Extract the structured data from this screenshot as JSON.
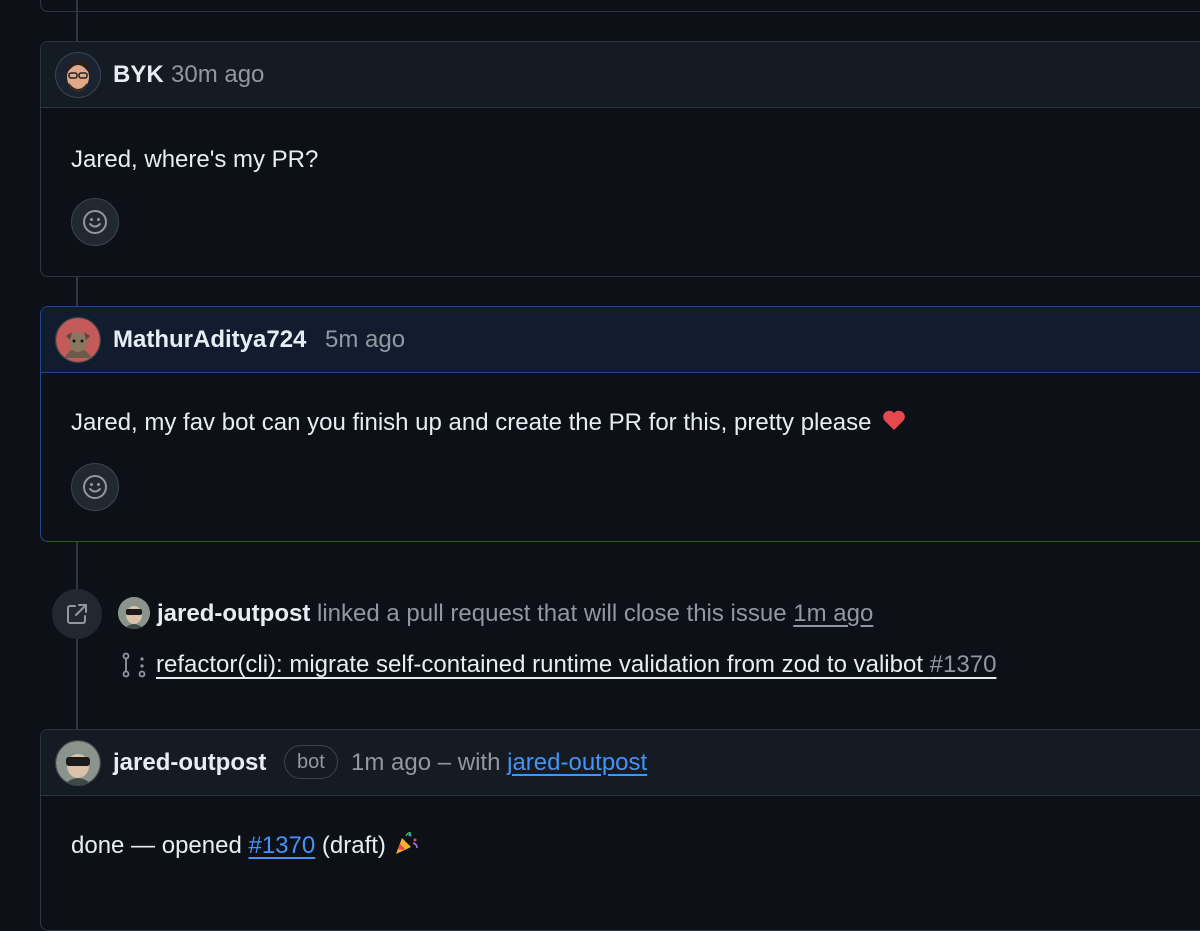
{
  "comments": [
    {
      "author": "BYK",
      "time": "30m ago",
      "body": "Jared, where's my PR?"
    },
    {
      "author": "MathurAditya724",
      "time": "5m ago",
      "body": "Jared, my fav bot can you finish up and create the PR for this, pretty please"
    }
  ],
  "event": {
    "actor": "jared-outpost",
    "text": "linked a pull request that will close this issue",
    "time": "1m ago",
    "pr_title": "refactor(cli): migrate self-contained runtime validation from zod to valibot",
    "pr_number": "#1370"
  },
  "bot_comment": {
    "author": "jared-outpost",
    "badge": "bot",
    "time": "1m ago",
    "with_text": "– with",
    "with_link": "jared-outpost",
    "body_prefix": "done — opened",
    "body_link": "#1370",
    "body_suffix": "(draft)"
  },
  "colors": {
    "background": "#0d1117",
    "border": "#30363d",
    "highlight_border": "#1f4a8a",
    "link": "#4493f8",
    "muted": "#9198a1"
  },
  "icons": [
    "smiley-icon",
    "cross-reference-icon",
    "pull-request-draft-icon",
    "heart-emoji",
    "party-popper-emoji"
  ]
}
